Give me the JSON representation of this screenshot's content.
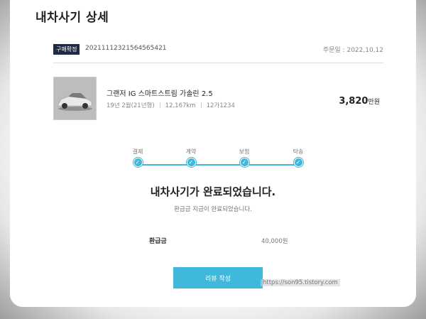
{
  "page": {
    "title": "내차사기 상세"
  },
  "order": {
    "badge": "구매확정",
    "number": "20211112321564565421",
    "date": "주문일 : 2022,10,12"
  },
  "car": {
    "name": "그랜저 IG 스마트스트림 가솔린 2.5",
    "year": "19년 2월(21년형)",
    "mileage": "12,167km",
    "plate": "12가1234",
    "price_value": "3,820",
    "price_unit": "만원",
    "image_icon": "car-image"
  },
  "steps": [
    {
      "label": "결제",
      "check": "✓"
    },
    {
      "label": "계약",
      "check": "✓"
    },
    {
      "label": "보험",
      "check": "✓"
    },
    {
      "label": "탁송",
      "check": "✓"
    }
  ],
  "status": {
    "title": "내차사기가 완료되었습니다.",
    "subtitle": "환급금 지급이 완료되었습니다."
  },
  "refund": {
    "label": "환급금",
    "value": "40,000원"
  },
  "actions": {
    "review_label": "리뷰 작성"
  },
  "watermark": "https://son95.tistory.com",
  "colors": {
    "accent": "#40b8dc",
    "badge_bg": "#1f2a44"
  }
}
